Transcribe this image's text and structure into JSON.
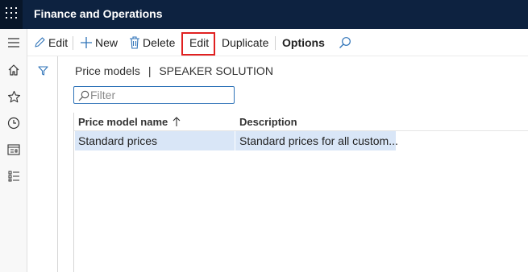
{
  "app": {
    "title": "Finance and Operations"
  },
  "actionbar": {
    "edit_mode_label": "Edit",
    "new_label": "New",
    "delete_label": "Delete",
    "edit_label": "Edit",
    "duplicate_label": "Duplicate",
    "options_label": "Options"
  },
  "page": {
    "breadcrumb_entity": "Price models",
    "breadcrumb_separator": "|",
    "breadcrumb_company": "SPEAKER SOLUTION"
  },
  "filter": {
    "placeholder": "Filter"
  },
  "grid": {
    "columns": [
      {
        "label": "Price model name",
        "sort": "ascending"
      },
      {
        "label": "Description"
      }
    ],
    "rows": [
      {
        "name": "Standard prices",
        "description": "Standard prices for all custom...",
        "selected": true
      }
    ]
  },
  "colors": {
    "topbar": "#0d2240",
    "selected_row": "#d9e6f7",
    "highlight": "#e02020",
    "accent": "#2f73b8"
  },
  "icons": [
    "waffle-icon",
    "hamburger-icon",
    "home-icon",
    "star-icon",
    "clock-icon",
    "workspace-icon",
    "list-icon",
    "pencil-icon",
    "plus-icon",
    "trash-icon",
    "search-icon",
    "funnel-icon",
    "sort-arrow-icon"
  ]
}
